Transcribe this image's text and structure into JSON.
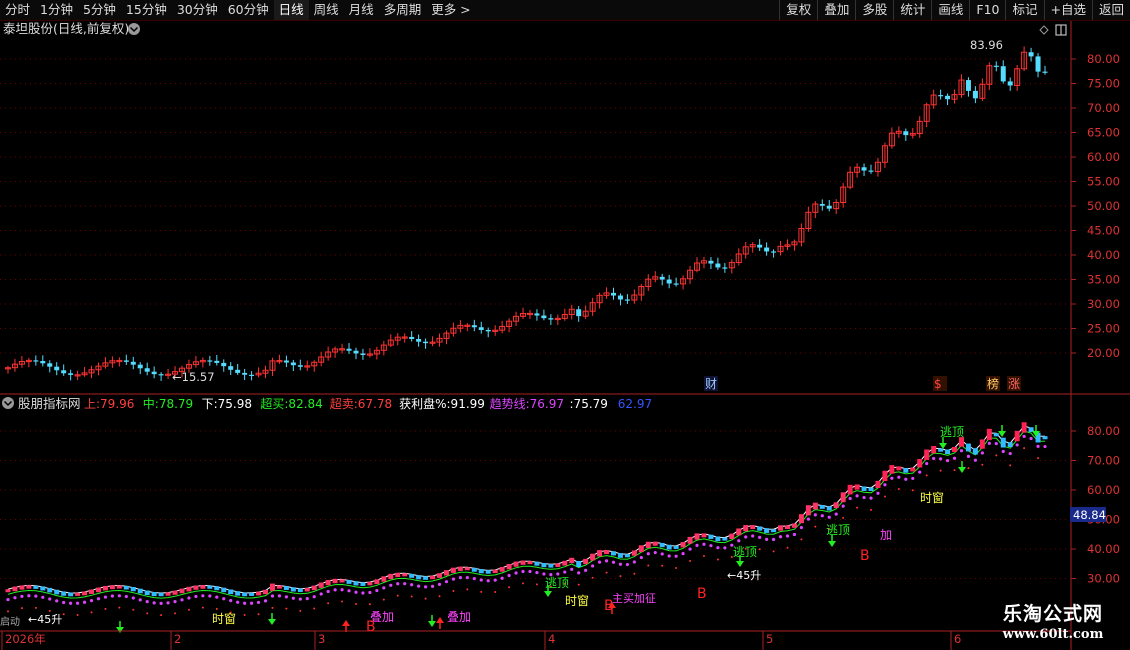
{
  "toolbar": {
    "periods": [
      "分时",
      "1分钟",
      "5分钟",
      "15分钟",
      "30分钟",
      "60分钟",
      "日线",
      "周线",
      "月线",
      "多周期",
      "更多 >"
    ],
    "active_period": "日线",
    "right_buttons": [
      "复权",
      "叠加",
      "多股",
      "统计",
      "画线",
      "F10",
      "标记",
      "+自选",
      "返回"
    ]
  },
  "stock_title": "泰坦股份(日线,前复权)",
  "price_axis": [
    "80.00",
    "75.00",
    "70.00",
    "65.00",
    "60.00",
    "55.00",
    "50.00",
    "45.00",
    "40.00",
    "35.00",
    "30.00",
    "25.00",
    "20.00"
  ],
  "high_label": "83.96",
  "low_label": "15.57",
  "event_badges": [
    {
      "text": "财",
      "color": "#9cf"
    },
    {
      "text": "$",
      "color": "#f44"
    },
    {
      "text": "榜",
      "color": "#fc6"
    },
    {
      "text": "涨",
      "color": "#f66"
    }
  ],
  "indicator": {
    "name": "股朋指标网",
    "items": [
      {
        "label": "上:",
        "value": "79.96",
        "color": "#ff4040"
      },
      {
        "label": "中:",
        "value": "78.79",
        "color": "#22ee22"
      },
      {
        "label": "下:",
        "value": "75.98",
        "color": "#ffffff"
      },
      {
        "label": "超买:",
        "value": "82.84",
        "color": "#22ee22"
      },
      {
        "label": "超卖:",
        "value": "67.78",
        "color": "#ff4040"
      },
      {
        "label": "获利盘%:",
        "value": "91.99",
        "color": "#ffffff"
      },
      {
        "label": "趋势线:",
        "value": "76.97",
        "color": "#dd44ff"
      },
      {
        "label": ":",
        "value": "75.79",
        "color": "#ffffff"
      },
      {
        "label": "",
        "value": "62.97",
        "color": "#3355ff"
      }
    ]
  },
  "indicator_axis": [
    "80.00",
    "70.00",
    "60.00",
    "50.00",
    "40.00",
    "30.00"
  ],
  "current_value_tag": "48.84",
  "signal_labels": {
    "escape": "逃顶",
    "timing": "时窗",
    "add": "加",
    "add_full": "叠加",
    "buy": "B",
    "rise": "45升",
    "start": "启动",
    "mixed": "主买加征"
  },
  "date_axis": [
    "2026年",
    "2",
    "3",
    "4",
    "5",
    "6"
  ],
  "watermark": {
    "cn": "乐淘公式网",
    "url": "www.60lt.com"
  },
  "colors": {
    "up": "#ff3333",
    "down": "#55ddff",
    "grid": "#6b0000",
    "axis": "#aa2222"
  }
}
